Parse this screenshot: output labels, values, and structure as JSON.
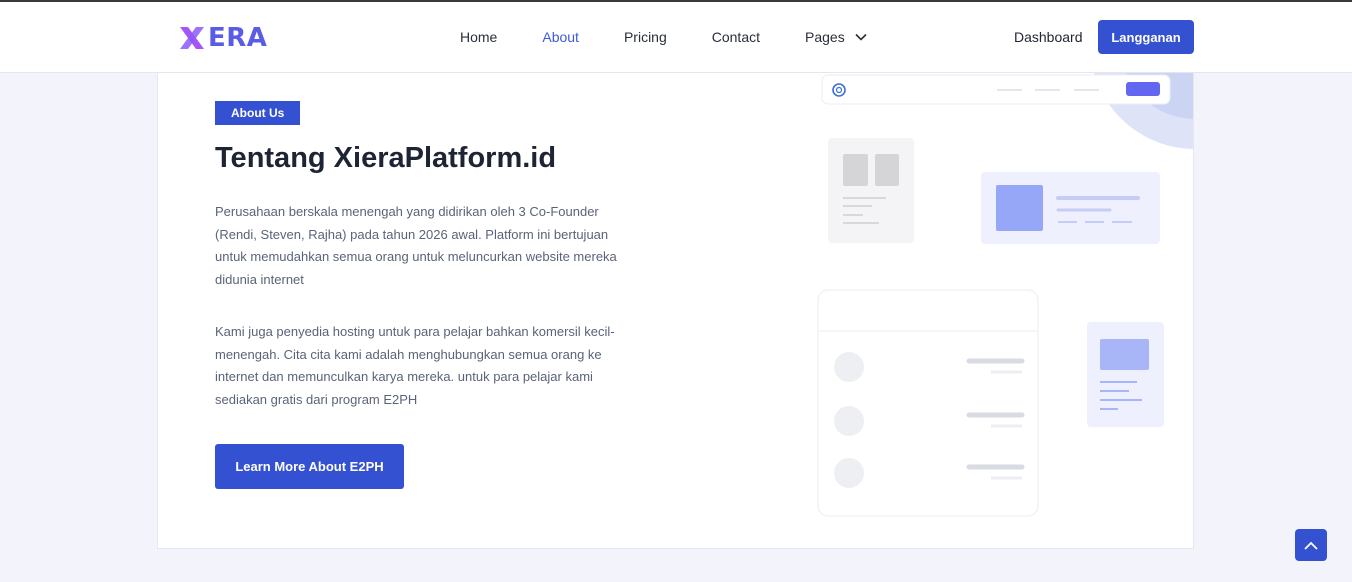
{
  "brand": {
    "name": "ERA",
    "logo_letter": "X"
  },
  "nav": {
    "items": [
      {
        "label": "Home",
        "active": false
      },
      {
        "label": "About",
        "active": true
      },
      {
        "label": "Pricing",
        "active": false
      },
      {
        "label": "Contact",
        "active": false
      }
    ],
    "pages_label": "Pages",
    "dashboard_label": "Dashboard",
    "subscribe_label": "Langganan"
  },
  "about": {
    "badge": "About Us",
    "title": "Tentang XieraPlatform.id",
    "paragraph1": "Perusahaan berskala menengah yang didirikan oleh 3 Co-Founder (Rendi, Steven, Rajha) pada tahun 2026 awal. Platform ini bertujuan untuk memudahkan semua orang untuk meluncurkan website mereka didunia internet",
    "paragraph2": "Kami juga penyedia hosting untuk para pelajar bahkan komersil kecil-menengah. Cita cita kami adalah menghubungkan semua orang ke internet dan memunculkan karya mereka. untuk para pelajar kami sediakan gratis dari program E2PH",
    "button_label": "Learn More About E2PH"
  },
  "icons": {
    "logo": "x-logo-icon",
    "dropdown": "chevron-down-icon",
    "scroll_top": "chevron-up-icon",
    "mock_browser": "globe-icon"
  },
  "colors": {
    "accent": "#3451d1",
    "active_link": "#3b5bdb",
    "logo_purple": "#a855f7",
    "logo_blue": "#5b5ce6",
    "page_bg": "#f2f3fb"
  }
}
